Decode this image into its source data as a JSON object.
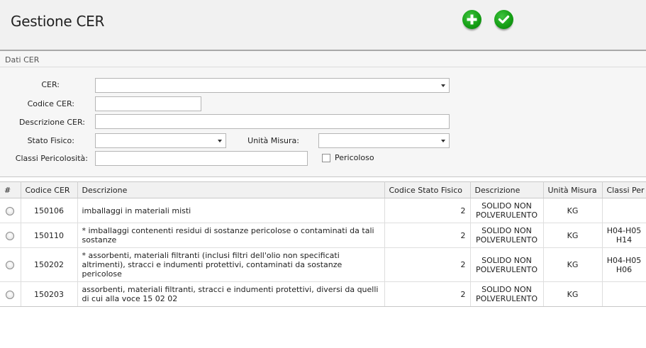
{
  "header": {
    "title": "Gestione CER",
    "add_icon": "plus-circle-icon",
    "confirm_icon": "check-circle-icon",
    "accent_color": "#16a016"
  },
  "form": {
    "section_title": "Dati CER",
    "cer_label": "CER:",
    "cer_value": "",
    "codice_label": "Codice CER:",
    "codice_value": "",
    "descrizione_label": "Descrizione CER:",
    "descrizione_value": "",
    "stato_label": "Stato Fisico:",
    "stato_value": "",
    "unita_label": "Unità Misura:",
    "unita_value": "",
    "classi_label": "Classi Pericolosità:",
    "classi_value": "",
    "pericoloso_label": "Pericoloso",
    "pericoloso_checked": false
  },
  "table": {
    "columns": [
      "#",
      "Codice CER",
      "Descrizione",
      "Codice Stato Fisico",
      "Descrizione",
      "Unità Misura",
      "Classi Per"
    ],
    "rows": [
      {
        "codice": "150106",
        "descrizione": "imballaggi in materiali misti",
        "stato_codice": "2",
        "stato_desc": "SOLIDO NON POLVERULENTO",
        "unita": "KG",
        "classi": ""
      },
      {
        "codice": "150110",
        "descrizione": "* imballaggi contenenti residui di sostanze pericolose o contaminati da tali sostanze",
        "stato_codice": "2",
        "stato_desc": "SOLIDO NON POLVERULENTO",
        "unita": "KG",
        "classi": "H04-H05 H14"
      },
      {
        "codice": "150202",
        "descrizione": "* assorbenti, materiali filtranti (inclusi filtri dell'olio non specificati altrimenti), stracci e indumenti protettivi, contaminati da sostanze pericolose",
        "stato_codice": "2",
        "stato_desc": "SOLIDO NON POLVERULENTO",
        "unita": "KG",
        "classi": "H04-H05 H06"
      },
      {
        "codice": "150203",
        "descrizione": "assorbenti, materiali filtranti, stracci e indumenti protettivi, diversi da quelli di cui alla voce 15 02 02",
        "stato_codice": "2",
        "stato_desc": "SOLIDO NON POLVERULENTO",
        "unita": "KG",
        "classi": ""
      }
    ]
  }
}
